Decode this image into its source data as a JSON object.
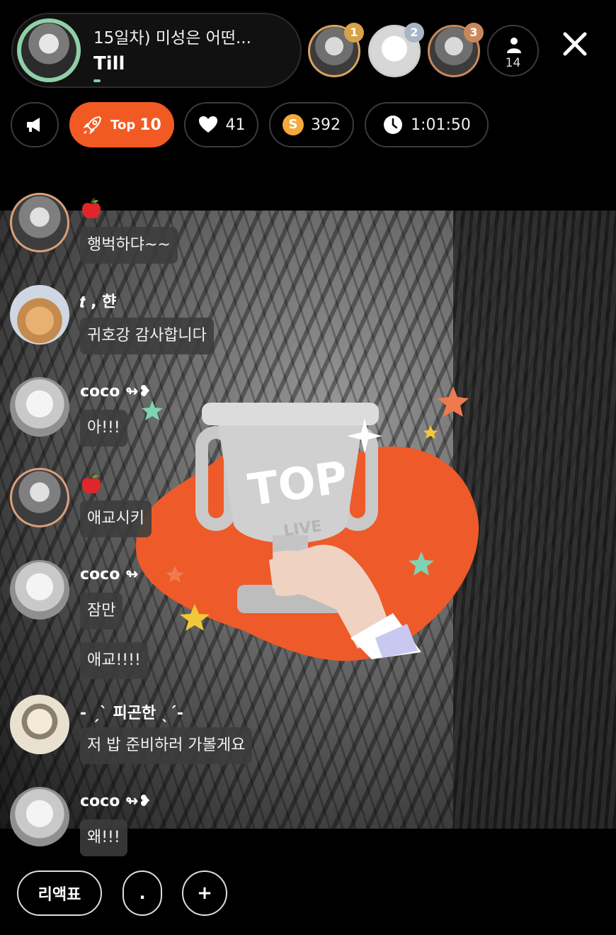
{
  "header": {
    "title": "15일차) 미성은 어떤...",
    "host_name": "Till",
    "viewers": [
      {
        "rank": "1",
        "badge_color": "#d8a24a"
      },
      {
        "rank": "2",
        "badge_color": "#a7b5c5"
      },
      {
        "rank": "3",
        "badge_color": "#c9885c"
      }
    ],
    "viewer_count": "14"
  },
  "stats": {
    "top_rank_label": "Top",
    "top_rank_value": "10",
    "likes": "41",
    "coins_symbol": "S",
    "coins": "392",
    "elapsed": "1:01:50"
  },
  "overlay": {
    "trophy_text": "TOP",
    "trophy_subtext": "LIVE"
  },
  "chat": [
    {
      "user": "",
      "has_apple": true,
      "messages": [
        "행벅하댜~~"
      ]
    },
    {
      "user": "𝒕 , 햔",
      "has_apple": false,
      "messages": [
        "귀호강 감사합니다"
      ]
    },
    {
      "user": "coco ↬❥",
      "has_apple": false,
      "messages": [
        "아!!!"
      ]
    },
    {
      "user": "",
      "has_apple": true,
      "messages": [
        "애교시키"
      ]
    },
    {
      "user": "coco ↬",
      "has_apple": false,
      "messages": [
        "잠만",
        "애교!!!!"
      ]
    },
    {
      "user": "- ˏˋ 피곤한 ˎˊ-",
      "has_apple": false,
      "messages": [
        "저 밥 준비하러 가볼게요"
      ]
    },
    {
      "user": "coco ↬❥",
      "has_apple": false,
      "messages": [
        "왜!!!"
      ]
    }
  ],
  "bottom": {
    "reaction_label": "리액표",
    "dot_label": ".",
    "plus_label": "+"
  },
  "colors": {
    "accent": "#f25a24",
    "host_ring": "#8fd0a8",
    "coin": "#f5a83b"
  }
}
